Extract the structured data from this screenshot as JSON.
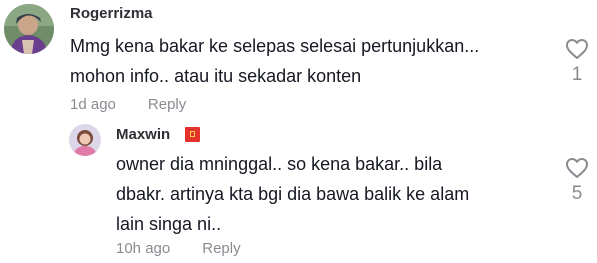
{
  "comment": {
    "author": "Rogerrizma",
    "text_lines": [
      "Mmg kena bakar ke selepas selesai pertunjukkan...",
      "mohon info.. atau itu sekadar konten"
    ],
    "time": "1d ago",
    "reply_label": "Reply",
    "likes": "1"
  },
  "reply": {
    "author": "Maxwin",
    "text_lines": [
      "owner dia mninggal.. so kena bakar.. bila",
      "dbakr. artinya kta bgi dia bawa balik ke alam",
      "lain singa ni.."
    ],
    "time": "10h ago",
    "reply_label": "Reply",
    "likes": "5"
  },
  "icons": {
    "like": "heart-outline-icon",
    "flag": "china-flag-icon"
  },
  "colors": {
    "text": "#161823",
    "secondary": "#8a8b91",
    "flag": "#e4312b"
  }
}
